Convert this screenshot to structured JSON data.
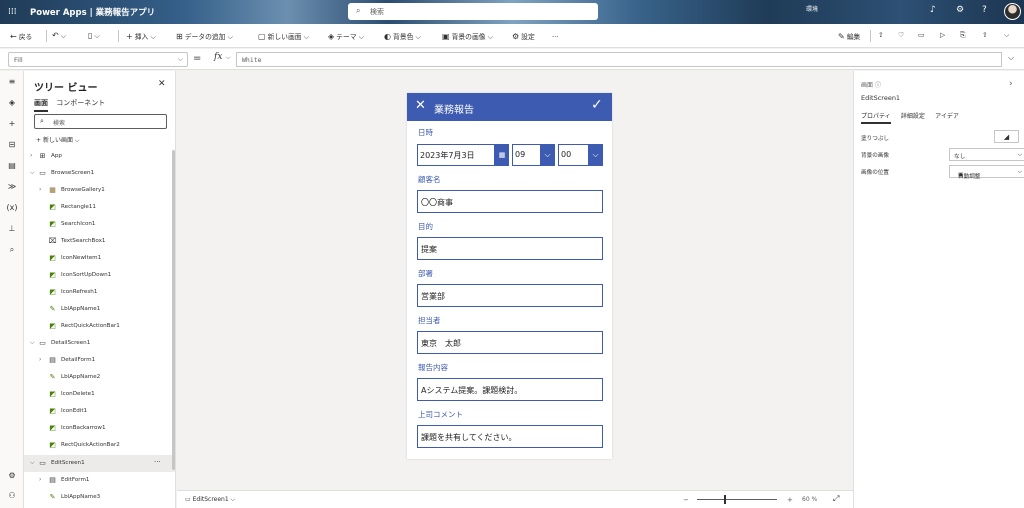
{
  "header": {
    "app_title": "Power Apps  |  業務報告アプリ",
    "search_placeholder": "検索",
    "environment": "環境"
  },
  "toolbar": {
    "back": "戻る",
    "insert": "挿入",
    "add_data": "データの追加",
    "new_screen": "新しい画面",
    "theme": "テーマ",
    "background_color": "背景色",
    "background_image": "背景の画像",
    "settings": "設定",
    "more": "...",
    "edit": "編集"
  },
  "formula": {
    "property": "Fill",
    "fx": "fx",
    "value": "White"
  },
  "tree": {
    "title": "ツリー ビュー",
    "tabs": [
      "画面",
      "コンポーネント"
    ],
    "search_placeholder": "検索",
    "new_screen": "新しい画面",
    "nodes": [
      {
        "label": "App"
      },
      {
        "label": "BrowseScreen1"
      },
      {
        "label": "BrowseGallery1"
      },
      {
        "label": "Rectangle11"
      },
      {
        "label": "SearchIcon1"
      },
      {
        "label": "TextSearchBox1"
      },
      {
        "label": "IconNewItem1"
      },
      {
        "label": "IconSortUpDown1"
      },
      {
        "label": "IconRefresh1"
      },
      {
        "label": "LblAppName1"
      },
      {
        "label": "RectQuickActionBar1"
      },
      {
        "label": "DetailScreen1"
      },
      {
        "label": "DetailForm1"
      },
      {
        "label": "LblAppName2"
      },
      {
        "label": "IconDelete1"
      },
      {
        "label": "IconEdit1"
      },
      {
        "label": "IconBackarrow1"
      },
      {
        "label": "RectQuickActionBar2"
      },
      {
        "label": "EditScreen1"
      },
      {
        "label": "EditForm1"
      },
      {
        "label": "LblAppName3"
      }
    ]
  },
  "screen": {
    "title": "業務報告",
    "fields": {
      "date_label": "日時",
      "date_value": "2023年7月3日",
      "hour": "09",
      "minute": "00",
      "customer_label": "顧客名",
      "customer_value": "〇〇商事",
      "purpose_label": "目的",
      "purpose_value": "提案",
      "department_label": "部署",
      "department_value": "営業部",
      "person_label": "担当者",
      "person_value": "東京　太郎",
      "report_label": "報告内容",
      "report_value": "Aシステム提案。課題検討。",
      "comment_label": "上司コメント",
      "comment_value": "課題を共有してください。"
    }
  },
  "bottom": {
    "screen_name": "EditScreen1",
    "zoom_minus": "−",
    "zoom_plus": "+",
    "zoom_pct": "60 %"
  },
  "props": {
    "kind": "画面",
    "name": "EditScreen1",
    "tabs": [
      "プロパティ",
      "詳細設定",
      "アイデア"
    ],
    "fill_label": "塗りつぶし",
    "bg_image_label": "背景の画像",
    "bg_image_value": "なし",
    "image_pos_label": "画像の位置",
    "image_pos_value": "自動調整"
  }
}
